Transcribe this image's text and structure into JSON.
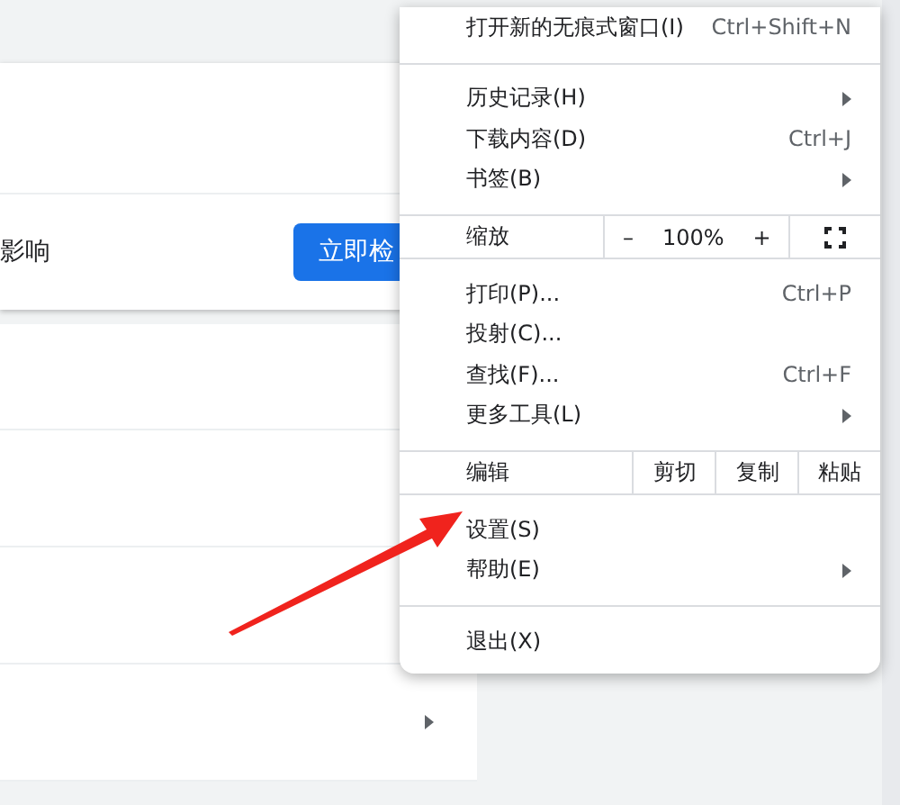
{
  "page": {
    "notice_text": "影响",
    "check_button": "立即检"
  },
  "menu": {
    "items": [
      {
        "kind": "item",
        "label": "打开新的无痕式窗口(I)",
        "shortcut": "Ctrl+Shift+N",
        "submenu": false
      },
      {
        "kind": "divider"
      },
      {
        "kind": "item",
        "label": "历史记录(H)",
        "submenu": true
      },
      {
        "kind": "item",
        "label": "下载内容(D)",
        "shortcut": "Ctrl+J",
        "submenu": false
      },
      {
        "kind": "item",
        "label": "书签(B)",
        "submenu": true
      },
      {
        "kind": "zoom",
        "label": "缩放",
        "minus": "–",
        "value": "100%",
        "plus": "+"
      },
      {
        "kind": "item",
        "label": "打印(P)...",
        "shortcut": "Ctrl+P",
        "submenu": false
      },
      {
        "kind": "item",
        "label": "投射(C)...",
        "submenu": false
      },
      {
        "kind": "item",
        "label": "查找(F)...",
        "shortcut": "Ctrl+F",
        "submenu": false
      },
      {
        "kind": "item",
        "label": "更多工具(L)",
        "submenu": true
      },
      {
        "kind": "edit",
        "label": "编辑",
        "actions": [
          "剪切",
          "复制",
          "粘贴"
        ]
      },
      {
        "kind": "item",
        "label": "设置(S)",
        "submenu": false
      },
      {
        "kind": "item",
        "label": "帮助(E)",
        "submenu": true
      },
      {
        "kind": "divider"
      },
      {
        "kind": "item",
        "label": "退出(X)",
        "submenu": false
      }
    ]
  }
}
